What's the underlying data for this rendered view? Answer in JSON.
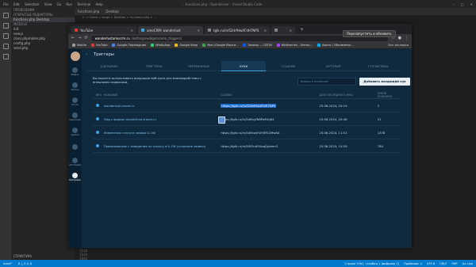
{
  "vscode": {
    "title_menu": [
      "File",
      "Edit",
      "Selection",
      "View",
      "Go",
      "Run",
      "Terminal",
      "Help"
    ],
    "window_title": "...functions.php - OpenServer - Visual Studio Code",
    "explorer_header": "ПРОВОДНИК",
    "open_editors": "ОТКРЫТЫЕ РЕДАКТОРЫ",
    "open_file": "functions.php  Desktop",
    "folder": "MODULE",
    "files": [
      "init",
      "new.js",
      "class.phpmailer.php",
      "config.php",
      "send.php"
    ],
    "tabs": [
      "functions.php",
      "Desktop"
    ],
    "breadcrumb": "C: > Users > serge > Desktop > functions.php > ...",
    "line_numbers": [
      "1938",
      "1939",
      "1940",
      "1941",
      "1942"
    ],
    "bottom_panel": "СТРУКТУРА",
    "status_left": [
      "main*",
      "0 △ 0 ⚠ 0"
    ],
    "status_right": [
      "Строка 1941, столбец 1 (выбрано 1)",
      "Пробелов: 2",
      "UTF-8",
      "CRLF",
      "PHP",
      "Go Live"
    ]
  },
  "chrome": {
    "tabs": [
      {
        "label": "YouTube"
      },
      {
        "label": "amoCRM: wanderlust"
      },
      {
        "label": "tglk.ru/in/S2drfHwXFdH7NPS"
      },
      {
        "label": ""
      }
    ],
    "new_tab": "+",
    "url_host": "wanderlustamocrm.ru",
    "url_path": "/settings/widgets/amo_triggers/",
    "tooltip": "Перезапустить и обновить",
    "bookmarks": [
      {
        "label": "Mobile",
        "color": "#999999"
      },
      {
        "label": "YouTube",
        "color": "#e53935"
      },
      {
        "label": "Google Переводчик",
        "color": "#4285f4"
      },
      {
        "label": "WhatsApp",
        "color": "#25d366"
      },
      {
        "label": "Google Keep",
        "color": "#fbbc04"
      },
      {
        "label": "Мои (Google Маски...",
        "color": "#34a853"
      },
      {
        "label": "Заказы — OZON",
        "color": "#005bff"
      },
      {
        "label": "Wildberries – Интер...",
        "color": "#a73afd"
      },
      {
        "label": "Авито | Объявлени...",
        "color": "#00aaff"
      }
    ],
    "all_bookmarks": "Все закладки"
  },
  "amo": {
    "nav": [
      {
        "label": "Задачи",
        "active": false
      },
      {
        "label": "Списки",
        "active": false
      },
      {
        "label": "Почта",
        "active": false
      },
      {
        "label": "Аналитика",
        "active": false
      },
      {
        "label": "Сделки",
        "active": false
      },
      {
        "label": "",
        "active": false
      },
      {
        "label": "amomarket",
        "active": false
      },
      {
        "label": "Настройки",
        "active": true
      }
    ],
    "back_arrow": "‹",
    "title": "Триггеры",
    "tabs": [
      {
        "label": "СЦЕНАРИИ",
        "active": false
      },
      {
        "label": "ТРИГГЕРЫ",
        "active": false
      },
      {
        "label": "ПЕРЕМЕННЫЕ",
        "active": false
      },
      {
        "label": "ХУКИ",
        "active": true
      },
      {
        "label": "ССЫЛКИ",
        "active": false
      },
      {
        "label": "ИСТОРИЯ",
        "active": false
      },
      {
        "label": "СТАТИСТИКА",
        "active": false
      }
    ],
    "description": "Вы можете использовать входящие веб-хуки для взаимодействия с внешними сервисами.",
    "search_placeholder": "Введите название",
    "add_button": "Добавить входящий хук",
    "columns": [
      "ВКЛ",
      "НАЗВАНИЕ",
      "ССЫЛКА",
      "ДАТА ПОСЛЕДНЕГО ХУКА",
      "ХУКОВ ПОЛУЧЕНО"
    ],
    "rows": [
      {
        "name": "wanderlust-travel.ru",
        "url": "https://tglk.ru/in/S2drfHwXFdH7NPS",
        "date": "25.06.2024, 20:19",
        "count": "2",
        "selected": true
      },
      {
        "name": "Лид с формы wanderlust-travel.ru",
        "url": "https://tglk.ru/in/5dBxyfN8Pe6Vq84",
        "date": "25.06.2024, 20:46",
        "count": "21",
        "selected": false
      },
      {
        "name": "Изменение статуса заявки U-ON",
        "url": "https://tglk.ru/in/5dEkwjFvEMFE2MwN4",
        "date": "25.06.2024, 11:51",
        "count": "1378",
        "selected": false
      },
      {
        "name": "Привязывание с заведения по ссылку в U-ON (создание заявки)",
        "url": "https://tglk.ru/in/5f0Ond5XoqQybem3",
        "date": "25.06.2024, 14:59",
        "count": "764",
        "selected": false
      }
    ]
  }
}
